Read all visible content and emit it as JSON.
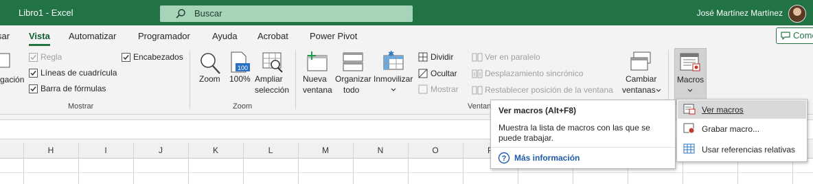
{
  "titlebar": {
    "doc_title": "Libro1  -  Excel",
    "search_placeholder": "Buscar",
    "user_name": "José Martínez Martínez"
  },
  "tabs": [
    {
      "label": "sar"
    },
    {
      "label": "Vista"
    },
    {
      "label": "Automatizar"
    },
    {
      "label": "Programador"
    },
    {
      "label": "Ayuda"
    },
    {
      "label": "Acrobat"
    },
    {
      "label": "Power Pivot"
    }
  ],
  "comment_button": "Come",
  "ribbon": {
    "mostrar": {
      "partial_label": "gación",
      "regla": "Regla",
      "encabezados": "Encabezados",
      "lineas": "Líneas de cuadrícula",
      "barra": "Barra de fórmulas",
      "group": "Mostrar"
    },
    "zoom": {
      "zoom": "Zoom",
      "cien": "100%",
      "ampliar_1": "Ampliar",
      "ampliar_2": "selección",
      "icon_100": "100",
      "group": "Zoom"
    },
    "ventana": {
      "nueva_1": "Nueva",
      "nueva_2": "ventana",
      "organizar_1": "Organizar",
      "organizar_2": "todo",
      "inmovilizar": "Inmovilizar",
      "dividir": "Dividir",
      "ocultar": "Ocultar",
      "mostrar": "Mostrar",
      "ver_paralelo": "Ver en paralelo",
      "desplazamiento": "Desplazamiento sincrónico",
      "restablecer": "Restablecer posición de la ventana",
      "cambiar_1": "Cambiar",
      "cambiar_2": "ventanas",
      "group_partial": "Ventan"
    },
    "macros": {
      "label": "Macros"
    }
  },
  "columns": [
    "H",
    "I",
    "J",
    "K",
    "L",
    "M",
    "N",
    "O",
    "P"
  ],
  "tooltip": {
    "title": "Ver macros (Alt+F8)",
    "description": "Muestra la lista de macros con las que se puede trabajar.",
    "more": "Más información"
  },
  "menu": [
    {
      "label": "Ver macros",
      "icon": "view-macros-icon"
    },
    {
      "label": "Grabar macro...",
      "icon": "record-macro-icon"
    },
    {
      "label": "Usar referencias relativas",
      "icon": "relative-references-icon"
    }
  ],
  "colors": {
    "excel_green": "#217346",
    "search_bg": "#a5d4b8",
    "link_blue": "#1e5aa8"
  }
}
